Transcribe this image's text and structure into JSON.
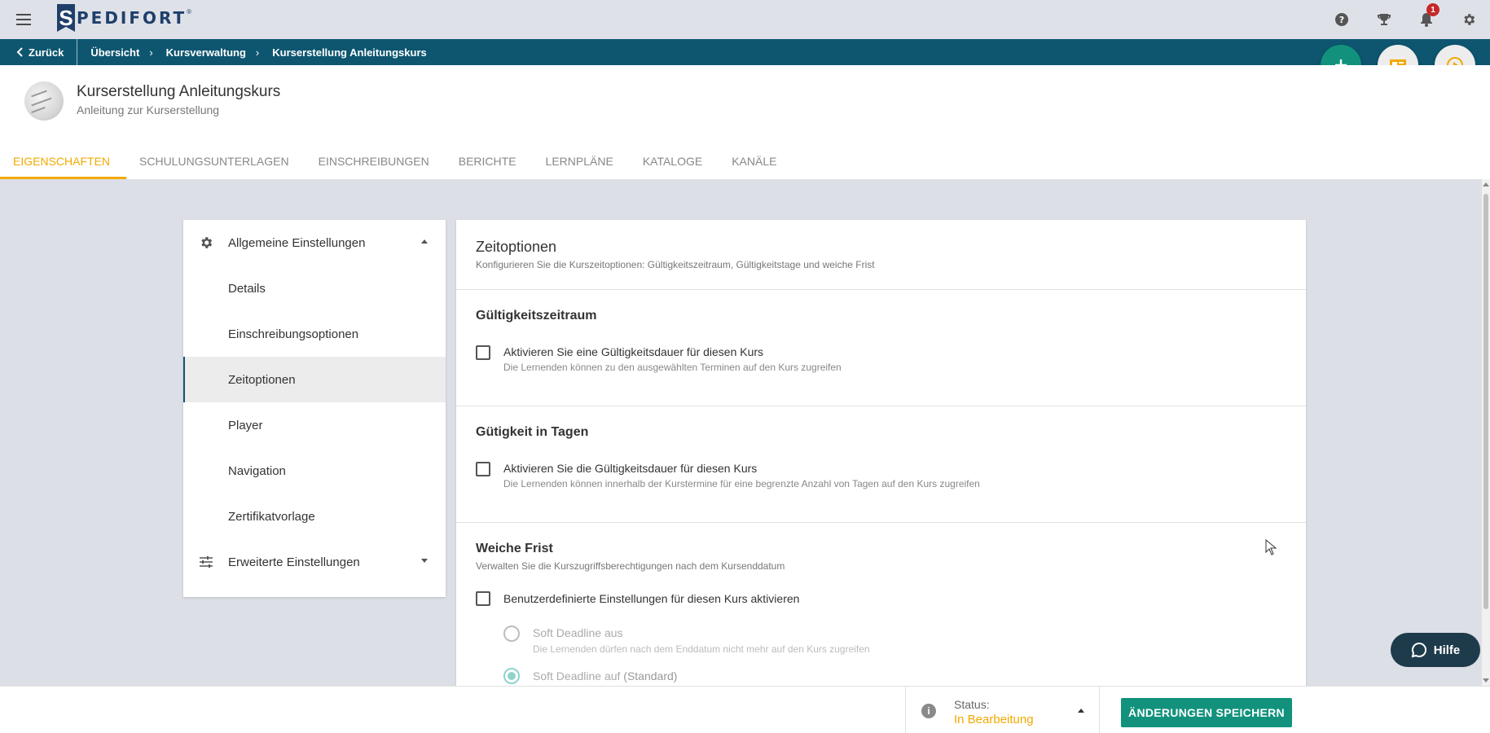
{
  "app": {
    "logo_letter": "S",
    "logo_text": "PEDIFORT",
    "logo_reg": "®"
  },
  "topbar": {
    "icons": [
      "menu-icon",
      "help-icon",
      "trophy-icon",
      "bell-icon",
      "gear-icon"
    ],
    "notification_count": "1"
  },
  "breadcrumb": {
    "back_label": "Zurück",
    "items": [
      "Übersicht",
      "Kursverwaltung",
      "Kurserstellung Anleitungskurs"
    ]
  },
  "course": {
    "title": "Kurserstellung Anleitungskurs",
    "subtitle": "Anleitung zur Kurserstellung"
  },
  "tabs": [
    {
      "label": "EIGENSCHAFTEN",
      "active": true
    },
    {
      "label": "SCHULUNGSUNTERLAGEN"
    },
    {
      "label": "EINSCHREIBUNGEN"
    },
    {
      "label": "BERICHTE"
    },
    {
      "label": "LERNPLÄNE"
    },
    {
      "label": "KATALOGE"
    },
    {
      "label": "KANÄLE"
    }
  ],
  "sidenav": {
    "general_label": "Allgemeine Einstellungen",
    "items": [
      "Details",
      "Einschreibungsoptionen",
      "Zeitoptionen",
      "Player",
      "Navigation",
      "Zertifikatvorlage"
    ],
    "selected": "Zeitoptionen",
    "advanced_label": "Erweiterte Einstellungen"
  },
  "content": {
    "title": "Zeitoptionen",
    "description": "Konfigurieren Sie die Kurszeitoptionen: Gültigkeitszeitraum, Gültigkeitstage und weiche Frist",
    "validity_period": {
      "title": "Gültigkeitszeitraum",
      "checkbox_label": "Aktivieren Sie eine Gültigkeitsdauer für diesen Kurs",
      "checkbox_hint": "Die Lernenden können zu den ausgewählten Terminen auf den Kurs zugreifen",
      "checked": false
    },
    "validity_days": {
      "title": "Gütigkeit in Tagen",
      "checkbox_label": "Aktivieren Sie die Gültigkeitsdauer für diesen Kurs",
      "checkbox_hint": "Die Lernenden können innerhalb der Kurstermine für eine begrenzte Anzahl von Tagen auf den Kurs zugreifen",
      "checked": false
    },
    "soft_deadline": {
      "title": "Weiche Frist",
      "description": "Verwalten Sie die Kurszugriffsberechtigungen nach dem Kursenddatum",
      "checkbox_label": "Benutzerdefinierte Einstellungen für diesen Kurs aktivieren",
      "checked": false,
      "options": [
        {
          "label": "Soft Deadline aus",
          "hint": "Die Lernenden dürfen nach dem Enddatum nicht mehr auf den Kurs zugreifen",
          "selected": false
        },
        {
          "label": "Soft Deadline auf",
          "suffix": "(Standard)",
          "selected": true
        }
      ]
    }
  },
  "help_button": {
    "label": "Hilfe"
  },
  "footer": {
    "status_label": "Status:",
    "status_value": "In Bearbeitung",
    "save_label": "ÄNDERUNGEN SPEICHERN"
  },
  "colors": {
    "primary_teal": "#12927c",
    "breadcrumb_bg": "#0e5670",
    "accent_orange": "#f2a900",
    "page_bg": "#dddfe7",
    "help_bg": "#1e3b4b"
  }
}
